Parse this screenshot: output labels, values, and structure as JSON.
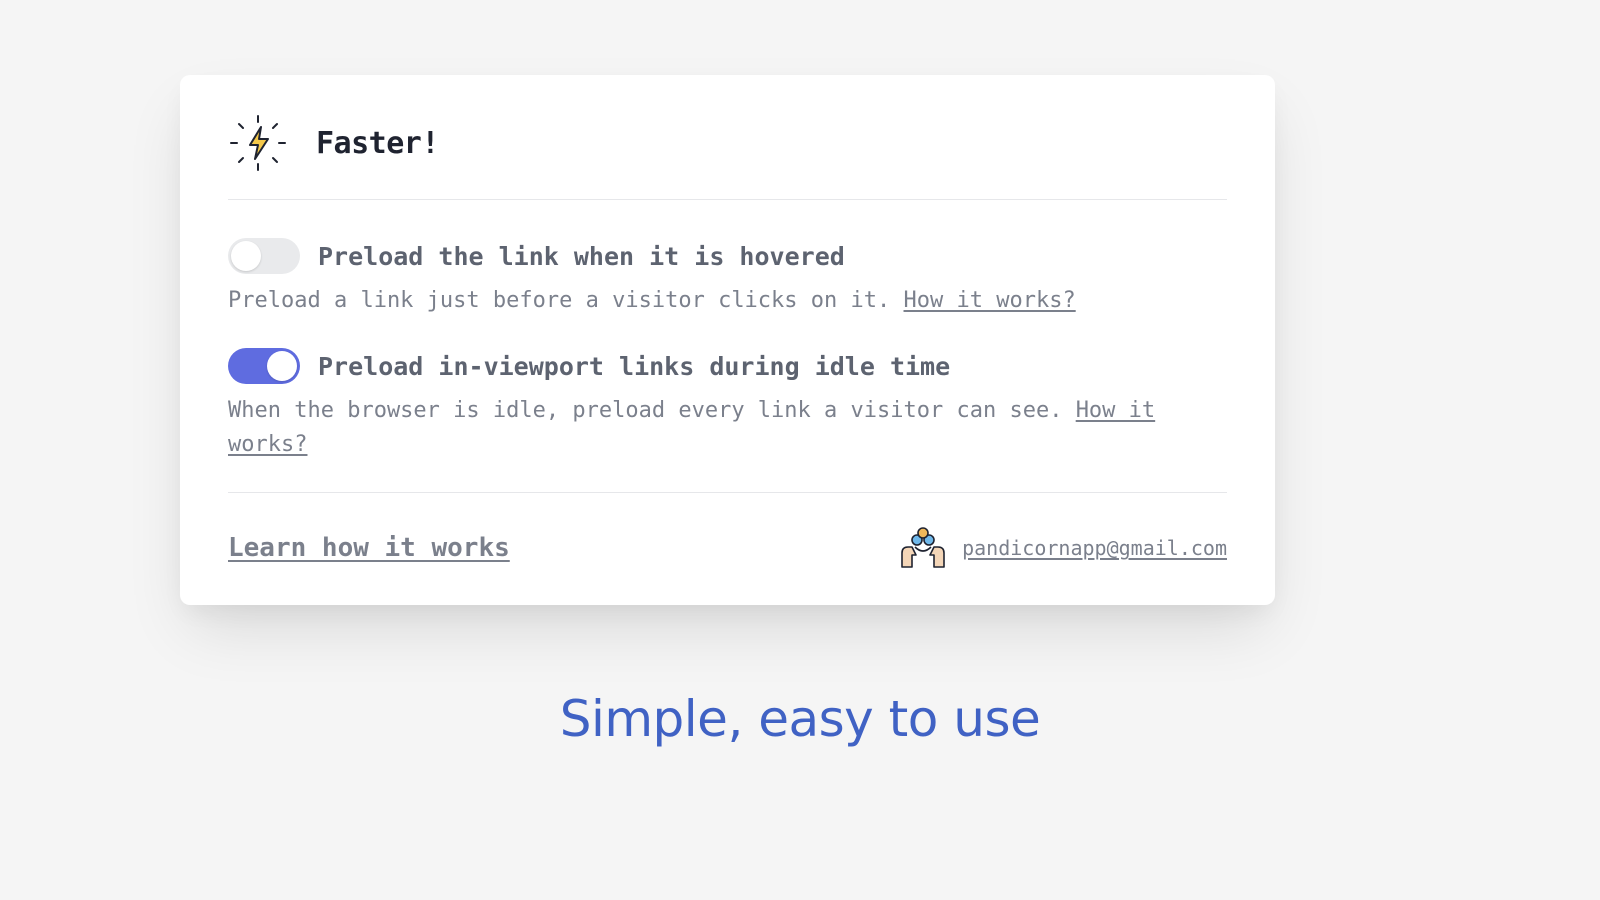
{
  "card": {
    "title": "Faster!",
    "settings": [
      {
        "enabled": false,
        "label": "Preload the link when it is hovered",
        "description": "Preload a link just before a visitor clicks on it. ",
        "how_link": "How it works?"
      },
      {
        "enabled": true,
        "label": "Preload in-viewport links during idle time",
        "description": "When the browser is idle, preload every link a visitor can see. ",
        "how_link": "How it works?"
      }
    ],
    "footer": {
      "learn_link": "Learn how it works",
      "contact_email": "pandicornapp@gmail.com"
    }
  },
  "tagline": "Simple, easy to use",
  "colors": {
    "accent": "#5f6ce0",
    "text_primary": "#1f2330",
    "text_secondary": "#5d6370",
    "text_muted": "#7b808c",
    "tagline": "#4062c4"
  },
  "icons": {
    "header_icon": "lightning-burst-icon",
    "support_icon": "hands-supporting-people-icon"
  }
}
